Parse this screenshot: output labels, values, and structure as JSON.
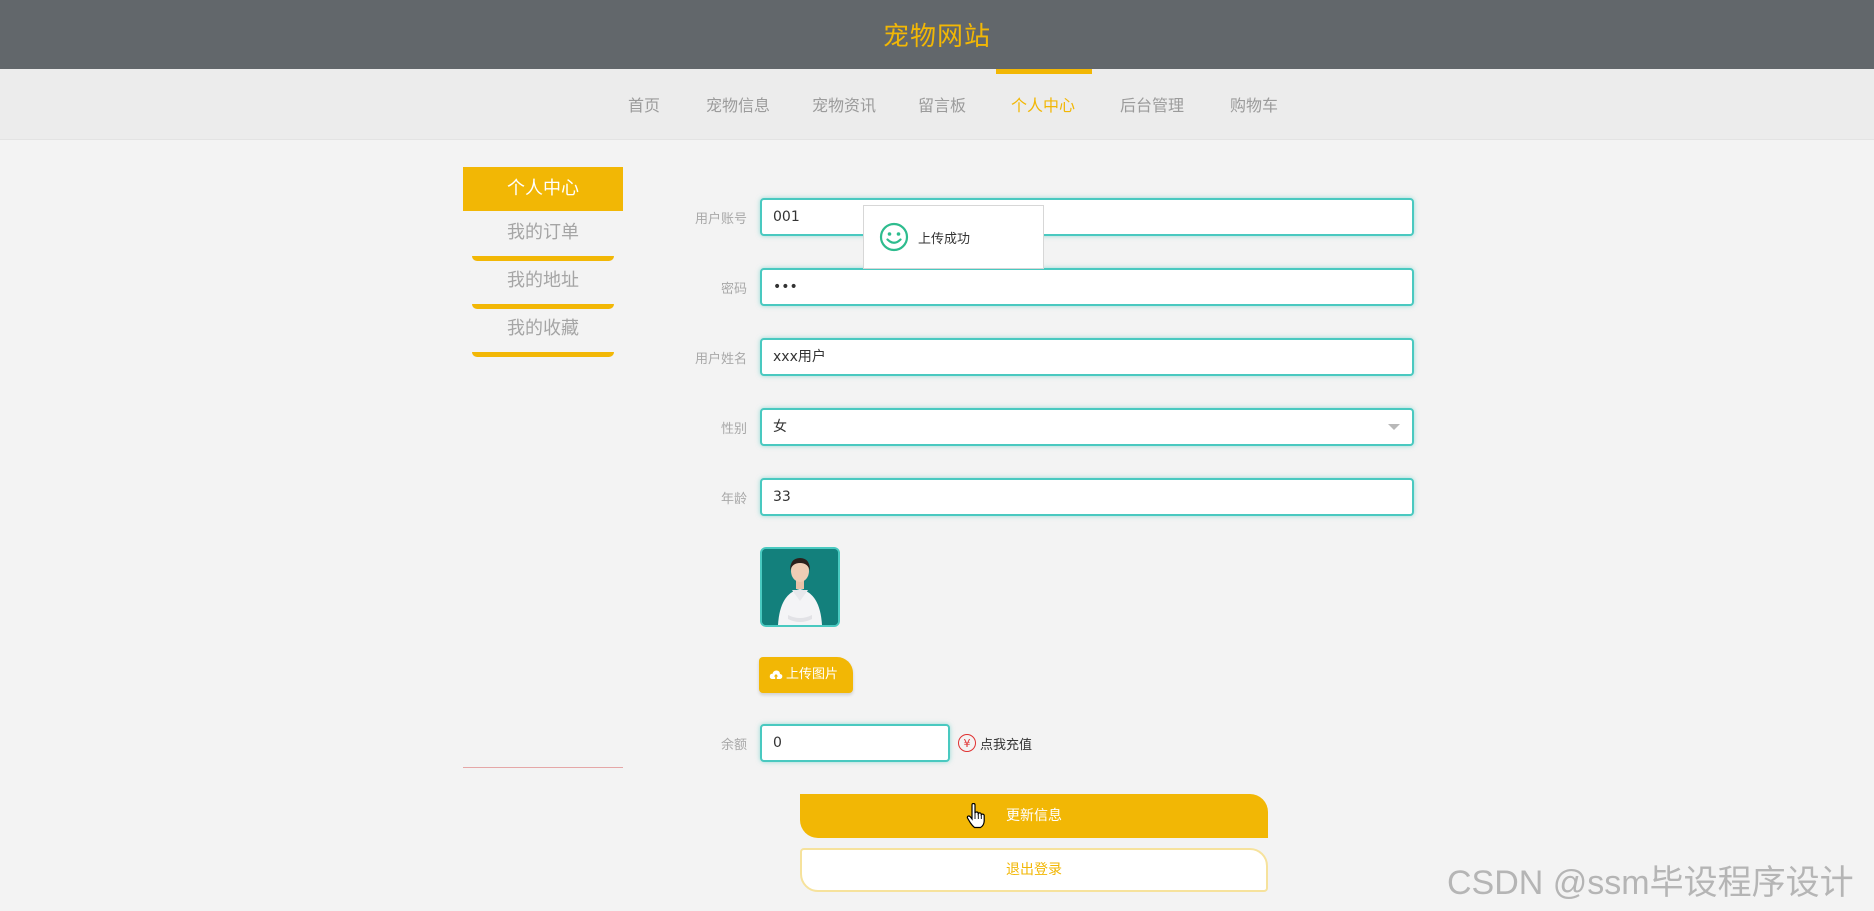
{
  "header": {
    "title": "宠物网站"
  },
  "nav": {
    "items": [
      {
        "label": "首页"
      },
      {
        "label": "宠物信息"
      },
      {
        "label": "宠物资讯"
      },
      {
        "label": "留言板"
      },
      {
        "label": "个人中心"
      },
      {
        "label": "后台管理"
      },
      {
        "label": "购物车"
      }
    ],
    "active_index": 4
  },
  "sidebar": {
    "active": "个人中心",
    "items": [
      {
        "label": "我的订单"
      },
      {
        "label": "我的地址"
      },
      {
        "label": "我的收藏"
      }
    ]
  },
  "form": {
    "username": {
      "label": "用户账号",
      "value": "001"
    },
    "password": {
      "label": "密码",
      "value": "•••"
    },
    "name": {
      "label": "用户姓名",
      "value": "xxx用户"
    },
    "gender": {
      "label": "性别",
      "value": "女"
    },
    "age": {
      "label": "年龄",
      "value": "33"
    },
    "upload_label": "上传图片",
    "balance": {
      "label": "余额",
      "value": "0"
    },
    "recharge_label": "点我充值",
    "recharge_icon": "¥",
    "update_label": "更新信息",
    "logout_label": "退出登录"
  },
  "toast": {
    "message": "上传成功"
  },
  "watermark": "CSDN @ssm毕设程序设计",
  "colors": {
    "accent": "#f2b705",
    "header_bg": "#62676b",
    "input_border": "#49c9c0"
  }
}
